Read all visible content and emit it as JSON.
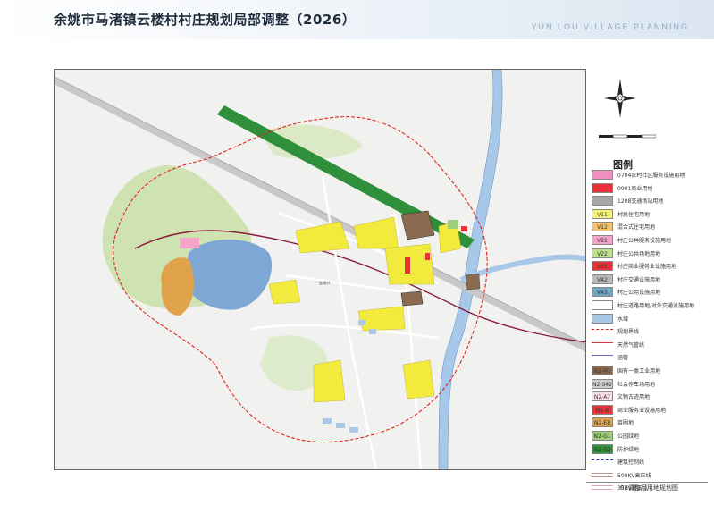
{
  "header": {
    "title": "余姚市马渚镇云楼村村庄规划局部调整（2026）",
    "brand": "YUN LOU  VILLAGE PLANNING"
  },
  "map": {
    "village_label": "云楼村",
    "colors": {
      "background": "#f1f1ef",
      "village_housing": "#f2ea3c",
      "water": "#7fa7d6",
      "river": "#a8c8ea",
      "commercial": "#e8323a",
      "industrial": "#8b6a4f",
      "forest_green": "#2f8f3a",
      "hill_green": "#c9dfa6",
      "park_orange": "#e0a24a",
      "boundary_red": "#e0261d",
      "railway": "#8a1b3d"
    }
  },
  "legend": {
    "title": "图例",
    "items": [
      {
        "code": "",
        "label": "0704农村社区服务设施用地",
        "color": "#f28ec0",
        "icon": "solid-swatch"
      },
      {
        "code": "",
        "label": "0901商业用地",
        "color": "#e8323a",
        "icon": "solid-swatch"
      },
      {
        "code": "",
        "label": "1208交通场站用地",
        "color": "#a6a6a6",
        "icon": "solid-swatch"
      },
      {
        "code": "V11",
        "label": "村民住宅用地",
        "color": "#f5f07a",
        "icon": "code-swatch"
      },
      {
        "code": "V12",
        "label": "混合式住宅用地",
        "color": "#f5c36c",
        "icon": "code-swatch"
      },
      {
        "code": "V21",
        "label": "村庄公共服务设施用地",
        "color": "#f4a4c8",
        "icon": "code-swatch"
      },
      {
        "code": "V22",
        "label": "村庄公共场地用地",
        "color": "#bfe38a",
        "icon": "code-swatch"
      },
      {
        "code": "V31",
        "label": "村庄商业服务业设施用地",
        "color": "#e8323a",
        "icon": "code-swatch"
      },
      {
        "code": "V42",
        "label": "村庄交通设施用地",
        "color": "#b9b9b9",
        "icon": "code-swatch"
      },
      {
        "code": "V43",
        "label": "村庄公用设施用地",
        "color": "#6fa6c4",
        "icon": "code-swatch"
      },
      {
        "code": "",
        "label": "村庄道路用地/对外交通设施用地",
        "color": "#ffffff",
        "icon": "solid-swatch"
      },
      {
        "code": "",
        "label": "水域",
        "color": "#a8c8ea",
        "icon": "solid-swatch"
      },
      {
        "code": "",
        "label": "规划界线",
        "color": "#e0261d",
        "icon": "dashed-line"
      },
      {
        "code": "",
        "label": "天然气管线",
        "color": "#d23a3a",
        "icon": "line"
      },
      {
        "code": "",
        "label": "涵管",
        "color": "#6b6bb5",
        "icon": "line"
      },
      {
        "code": "N2-M1",
        "label": "国有一类工业用地",
        "color": "#8b6a4f",
        "icon": "code-swatch"
      },
      {
        "code": "N2-S42",
        "label": "社会停车场用地",
        "color": "#cfcfcf",
        "icon": "code-swatch"
      },
      {
        "code": "N2-A7",
        "label": "文物古迹用地",
        "color": "#fbe0e8",
        "icon": "code-swatch"
      },
      {
        "code": "N2-B",
        "label": "商业服务业设施用地",
        "color": "#e8323a",
        "icon": "code-swatch"
      },
      {
        "code": "N2-E8",
        "label": "苗圃地",
        "color": "#e0a24a",
        "icon": "code-swatch"
      },
      {
        "code": "N2-G1",
        "label": "公园绿地",
        "color": "#9dce7a",
        "icon": "code-swatch"
      },
      {
        "code": "N2-G2",
        "label": "防护绿地",
        "color": "#2f8f3a",
        "icon": "code-swatch"
      },
      {
        "code": "",
        "label": "建筑控制线",
        "color": "#2a3fb3",
        "icon": "dashed-line"
      },
      {
        "code": "",
        "label": "500KV高压线",
        "color": "#c98f8f",
        "icon": "double-line"
      },
      {
        "code": "",
        "label": "35KV高压线",
        "color": "#d9a9a9",
        "icon": "double-line"
      }
    ]
  },
  "footer": {
    "sheet": "03调整后用地规划图"
  }
}
